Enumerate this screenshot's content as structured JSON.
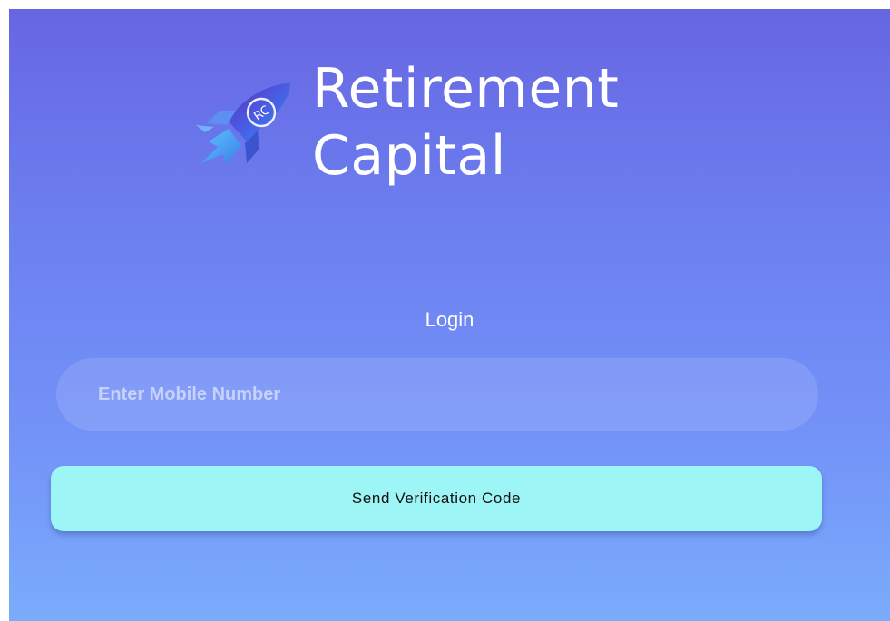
{
  "brand": {
    "logo_text": "RC",
    "line1": "Retirement",
    "line2": "Capital"
  },
  "login": {
    "title": "Login",
    "mobile_placeholder": "Enter Mobile Number",
    "mobile_value": "",
    "send_code_label": "Send Verification Code"
  },
  "colors": {
    "background_top": "#6766e2",
    "background_bottom": "#7aacfb",
    "button": "#9ef5f6",
    "text": "#ffffff"
  },
  "icons": {
    "logo": "rocket-icon"
  }
}
